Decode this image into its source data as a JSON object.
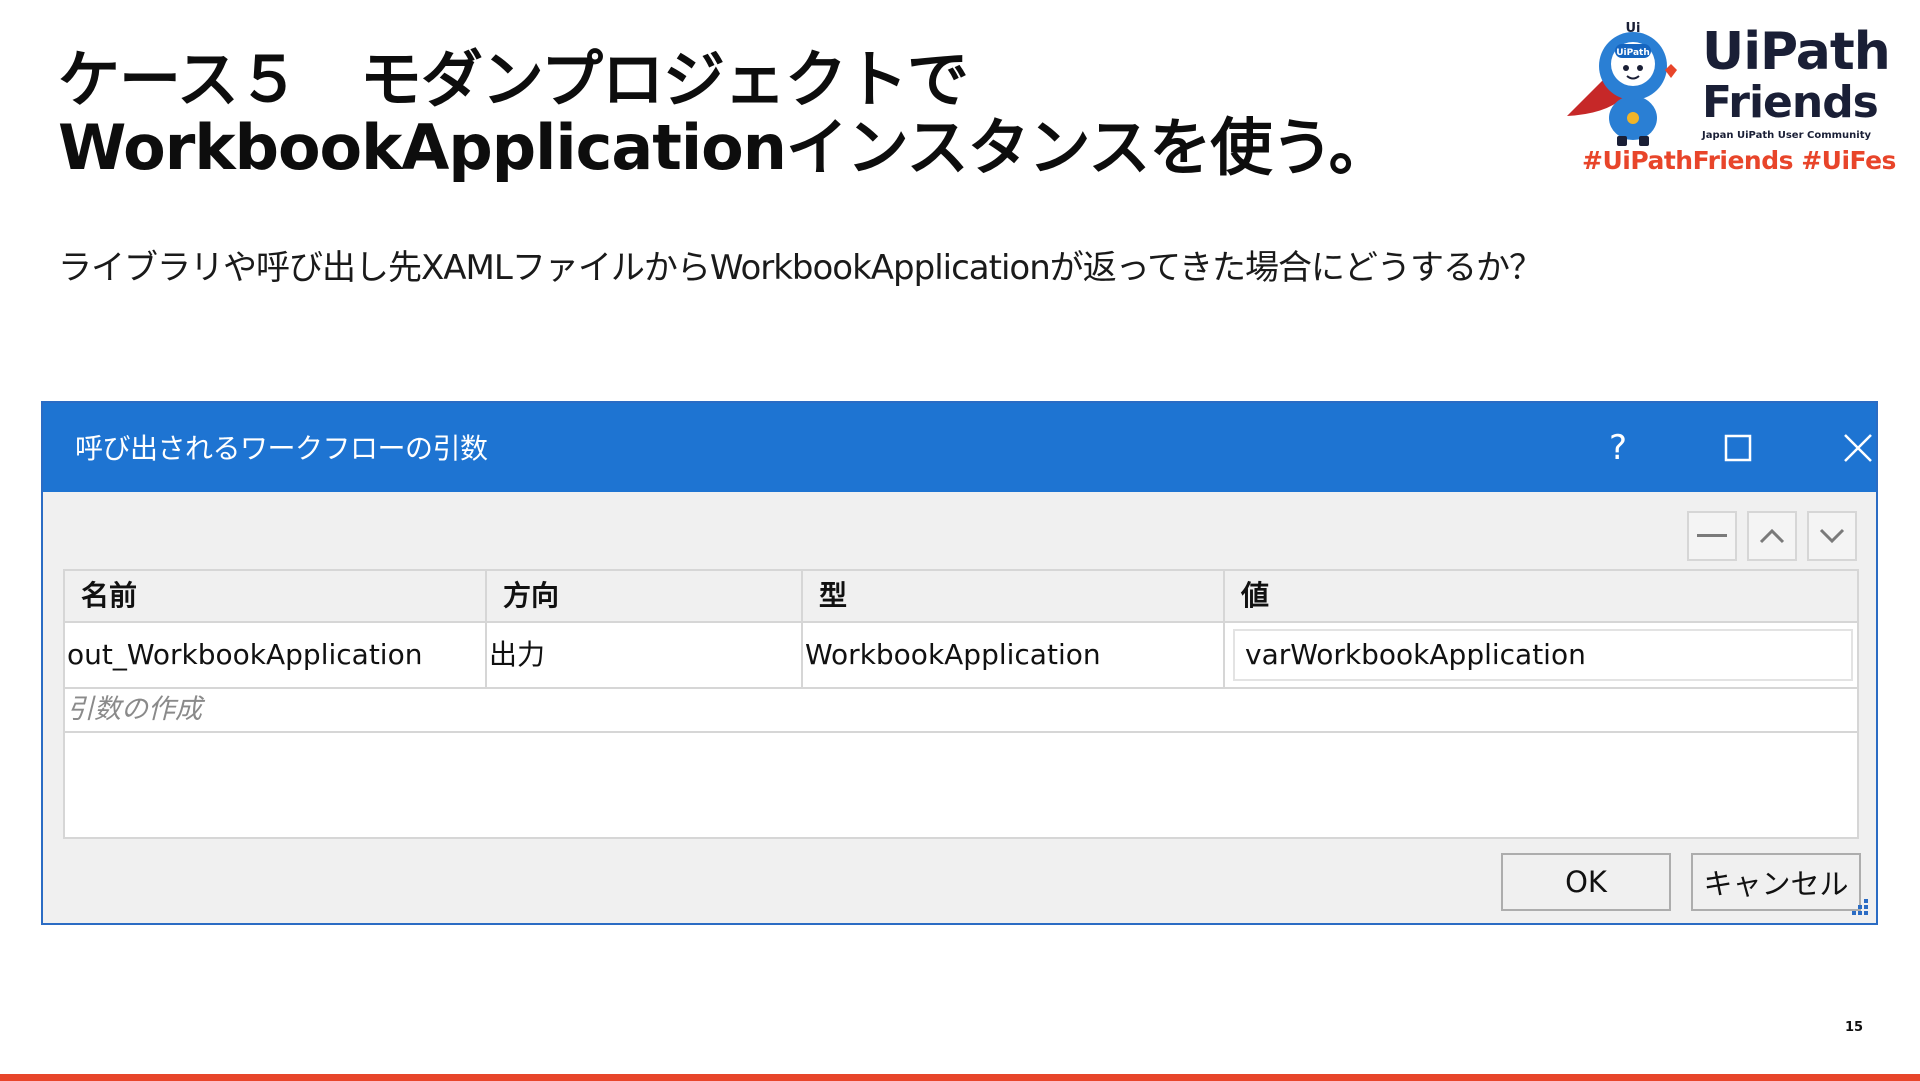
{
  "slide": {
    "title_line1": "ケース５　モダンプロジェクトで",
    "title_line2": "WorkbookApplicationインスタンスを使う。",
    "subtitle": "ライブラリや呼び出し先XAMLファイルからWorkbookApplicationが返ってきた場合にどうするか？",
    "page_number": "15"
  },
  "logo": {
    "badge": "UiPath",
    "ui_mark": "Ui",
    "name_line1": "UiPath",
    "name_line2": "Friends",
    "community": "Japan UiPath User Community",
    "hashtags": "#UiPathFriends  #UiFes"
  },
  "dialog": {
    "title": "呼び出されるワークフローの引数",
    "help_label": "?",
    "columns": [
      "名前",
      "方向",
      "型",
      "値"
    ],
    "rows": [
      {
        "name": "out_WorkbookApplication",
        "direction": "出力",
        "type": "WorkbookApplication",
        "value": "varWorkbookApplication"
      }
    ],
    "create_argument": "引数の作成",
    "ok_label": "OK",
    "cancel_label": "キャンセル"
  },
  "colors": {
    "titlebar": "#1e74d2",
    "accent": "#e8452a",
    "logo_text": "#1a1f36"
  },
  "icons": [
    "help-icon",
    "maximize-icon",
    "close-icon",
    "remove-icon",
    "move-up-icon",
    "move-down-icon",
    "resize-grip-icon"
  ]
}
